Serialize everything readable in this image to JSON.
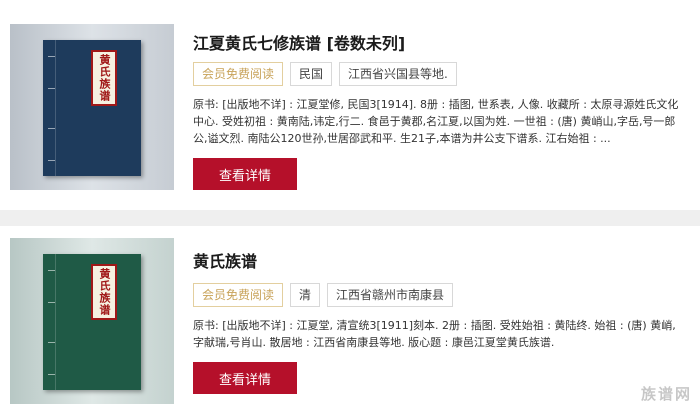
{
  "results": [
    {
      "cover_label": "黄氏族谱",
      "cover_color": "#1e3b5c",
      "title": "江夏黄氏七修族谱 [卷数未列]",
      "tags": [
        "会员免费阅读",
        "民国",
        "江西省兴国县等地."
      ],
      "description": "原书: [出版地不详] : 江夏堂修, 民国3[1914]. 8册 : 插图, 世系表, 人像. 收藏所 : 太原寻源姓氏文化中心. 受姓初祖 : 黄南陆,讳定,行二. 食邑于黄郡,名江夏,以国为姓. 一世祖 : (唐) 黄峭山,字岳,号一郎公,谥文烈. 南陆公120世孙,世居邵武和平. 生21子,本谱为井公支下谱系. 江右始祖 : ...",
      "button_label": "查看详情"
    },
    {
      "cover_label": "黄氏族谱",
      "cover_color": "#1f5a46",
      "title": "黄氏族谱",
      "tags": [
        "会员免费阅读",
        "清",
        "江西省赣州市南康县"
      ],
      "description": "原书: [出版地不详] : 江夏堂, 清宣统3[1911]刻本. 2册 : 插图. 受姓始祖 : 黄陆终. 始祖 : (唐) 黄峭,字献瑞,号肖山. 散居地 : 江西省南康县等地. 版心题 : 康邑江夏堂黄氏族谱.",
      "button_label": "查看详情"
    }
  ],
  "watermark": "族谱网"
}
